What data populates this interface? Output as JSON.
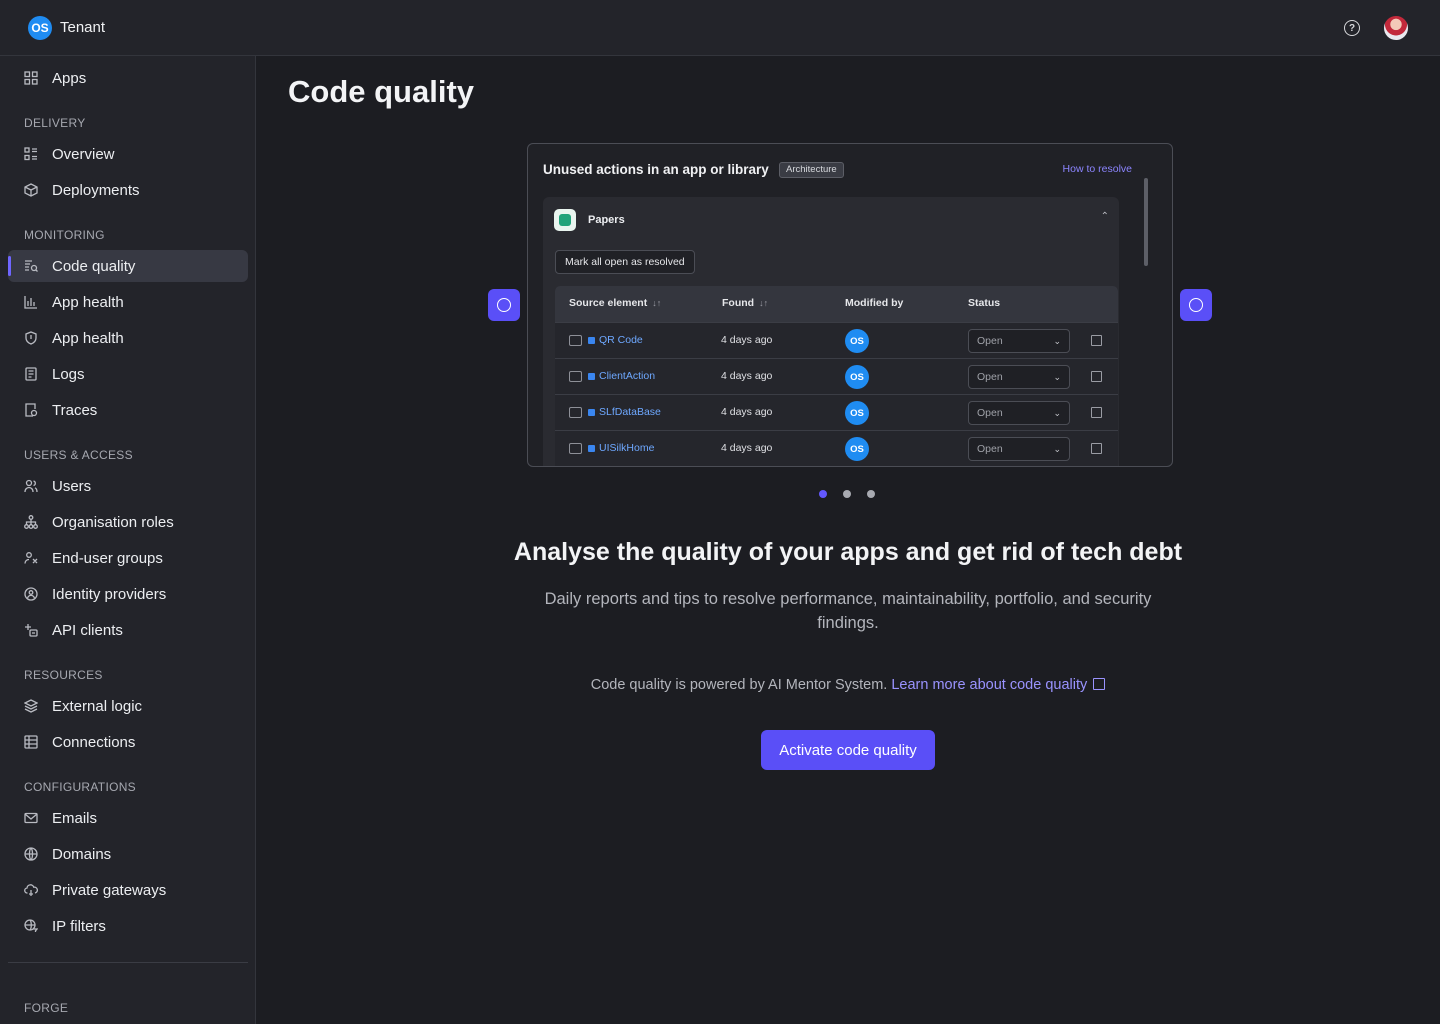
{
  "topbar": {
    "brand_logo": "OS",
    "brand_name": "Tenant",
    "help_icon": "question-circle-icon",
    "avatar": "user-avatar"
  },
  "sidebar": {
    "apps_label": "Apps",
    "sections": {
      "delivery": "DELIVERY",
      "monitoring": "MONITORING",
      "users_access": "USERS & ACCESS",
      "resources": "RESOURCES",
      "configurations": "CONFIGURATIONS",
      "forge": "FORGE"
    },
    "items": {
      "overview": "Overview",
      "deployments": "Deployments",
      "code_quality": "Code quality",
      "app_health_1": "App health",
      "app_health_2": "App health",
      "logs": "Logs",
      "traces": "Traces",
      "users": "Users",
      "org_roles": "Organisation roles",
      "end_user_groups": "End-user groups",
      "identity_providers": "Identity providers",
      "api_clients": "API clients",
      "external_logic": "External logic",
      "connections": "Connections",
      "emails": "Emails",
      "domains": "Domains",
      "private_gateways": "Private gateways",
      "ip_filters": "IP filters"
    },
    "active_item": "Code quality"
  },
  "main": {
    "title": "Code quality",
    "preview": {
      "title": "Unused actions in an app or library",
      "tag": "Architecture",
      "link": "How to resolve",
      "card_name": "Papers",
      "mark_button": "Mark all open as resolved",
      "columns": [
        "Source element",
        "Found",
        "Modified by",
        "Status"
      ],
      "rows": [
        {
          "source": "QR Code",
          "found": "4 days ago",
          "modified_by": "OS",
          "status": "Open"
        },
        {
          "source": "ClientAction",
          "found": "4 days ago",
          "modified_by": "OS",
          "status": "Open"
        },
        {
          "source": "SLfDataBase",
          "found": "4 days ago",
          "modified_by": "OS",
          "status": "Open"
        },
        {
          "source": "UISilkHome",
          "found": "4 days ago",
          "modified_by": "OS",
          "status": "Open"
        }
      ]
    },
    "carousel": {
      "slides": 3,
      "active_index": 0
    },
    "headline": "Analyse the quality of your apps and get rid of tech debt",
    "subline": "Daily reports and tips to resolve performance, maintainability, portfolio, and security findings.",
    "powered_text": "Code quality is powered by AI Mentor System.",
    "learn_more": "Learn more about code quality",
    "cta": "Activate code quality"
  },
  "colors": {
    "accent": "#5a4ff7",
    "brand_blue": "#1f8cf2",
    "link": "#9a93ff",
    "background": "#1c1d22"
  }
}
